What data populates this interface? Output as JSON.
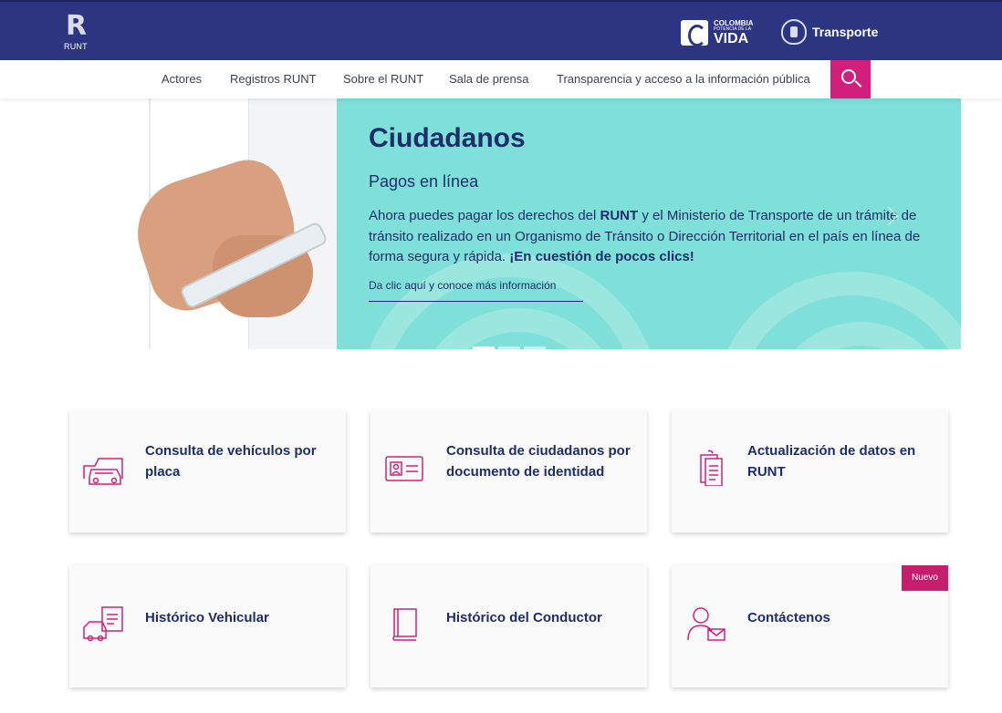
{
  "header": {
    "runt_logo_text": "RUNT",
    "colombia_logo": {
      "line1": "COLOMBIA",
      "line2": "POTENCIA DE LA",
      "line3": "VIDA"
    },
    "ministry_label": "Transporte"
  },
  "nav": {
    "items": [
      {
        "label": "Actores"
      },
      {
        "label": "Registros RUNT"
      },
      {
        "label": "Sobre el RUNT"
      },
      {
        "label": "Sala de prensa"
      },
      {
        "label": "Transparencia y acceso a la información pública"
      }
    ],
    "search_icon": "search-icon"
  },
  "hero": {
    "title": "Ciudadanos",
    "subtitle": "Pagos en línea",
    "body_part1": "Ahora puedes pagar los derechos del ",
    "body_bold1": "RUNT",
    "body_part2": " y el Ministerio de Transporte de un trámite de tránsito realizado en un Organismo de Tránsito o Dirección Territorial en el país en línea de forma segura y rápida. ",
    "body_bold2": "¡En cuestión de pocos clics!",
    "link": "Da clic aquí y conoce más información",
    "slide_count": 3,
    "active_slide": 1
  },
  "cards": [
    {
      "label": "Consulta de vehículos por placa",
      "icon": "car-icon"
    },
    {
      "label": "Consulta de ciudadanos por documento de identidad",
      "icon": "id-card-icon"
    },
    {
      "label": "Actualización de datos en RUNT",
      "icon": "document-update-icon"
    },
    {
      "label": "Histórico Vehicular",
      "icon": "vehicle-history-icon"
    },
    {
      "label": "Histórico del Conductor",
      "icon": "book-icon"
    },
    {
      "label": "Contáctenos",
      "icon": "contact-icon"
    }
  ],
  "badge": {
    "label": "Nuevo"
  },
  "colors": {
    "navy": "#2b3580",
    "magenta": "#d11f7c",
    "teal": "#7ee0d8",
    "text_dark": "#1f2d6b"
  }
}
